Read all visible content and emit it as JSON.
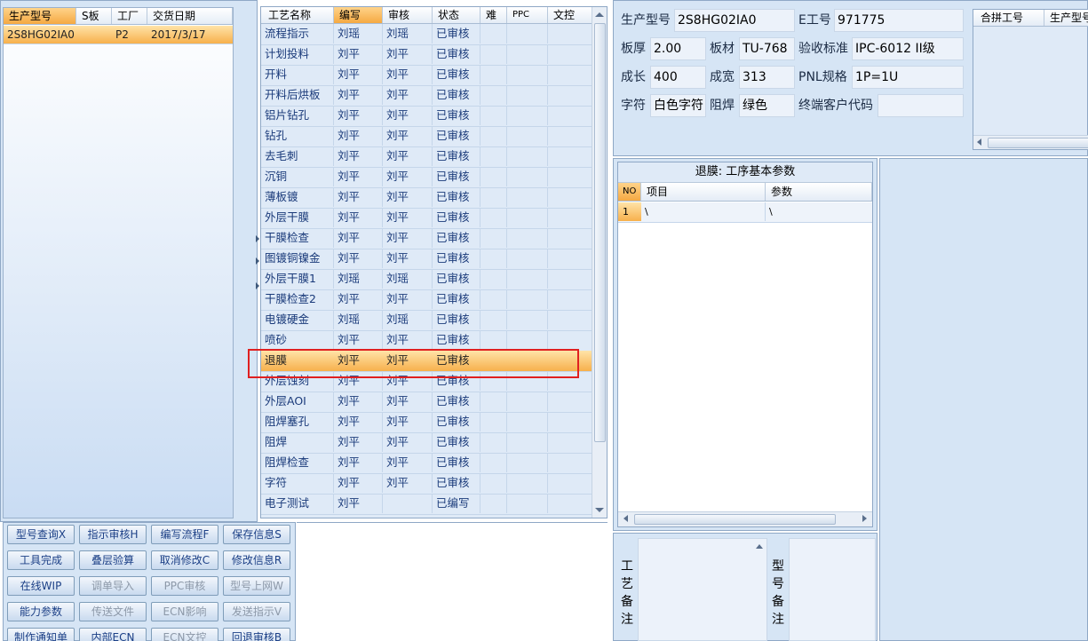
{
  "model_list": {
    "columns": [
      "生产型号",
      "S板",
      "工厂",
      "交货日期"
    ],
    "rows": [
      {
        "model": "2S8HG02IA0",
        "s_board": "",
        "factory": "P2",
        "delivery_date": "2017/3/17"
      }
    ]
  },
  "process_list": {
    "columns": [
      "工艺名称",
      "编写",
      "审核",
      "状态",
      "难",
      "PPC",
      "文控"
    ],
    "rows": [
      {
        "name": "流程指示",
        "writer": "刘瑶",
        "reviewer": "刘瑶",
        "status": "已审核"
      },
      {
        "name": "计划投料",
        "writer": "刘平",
        "reviewer": "刘平",
        "status": "已审核"
      },
      {
        "name": "开料",
        "writer": "刘平",
        "reviewer": "刘平",
        "status": "已审核"
      },
      {
        "name": "开料后烘板",
        "writer": "刘平",
        "reviewer": "刘平",
        "status": "已审核"
      },
      {
        "name": "铝片钻孔",
        "writer": "刘平",
        "reviewer": "刘平",
        "status": "已审核"
      },
      {
        "name": "钻孔",
        "writer": "刘平",
        "reviewer": "刘平",
        "status": "已审核"
      },
      {
        "name": "去毛刺",
        "writer": "刘平",
        "reviewer": "刘平",
        "status": "已审核"
      },
      {
        "name": "沉铜",
        "writer": "刘平",
        "reviewer": "刘平",
        "status": "已审核"
      },
      {
        "name": "薄板镀",
        "writer": "刘平",
        "reviewer": "刘平",
        "status": "已审核"
      },
      {
        "name": "外层干膜",
        "writer": "刘平",
        "reviewer": "刘平",
        "status": "已审核"
      },
      {
        "name": "干膜检查",
        "writer": "刘平",
        "reviewer": "刘平",
        "status": "已审核"
      },
      {
        "name": "图镀铜镍金",
        "writer": "刘平",
        "reviewer": "刘平",
        "status": "已审核"
      },
      {
        "name": "外层干膜1",
        "writer": "刘瑶",
        "reviewer": "刘瑶",
        "status": "已审核"
      },
      {
        "name": "干膜检查2",
        "writer": "刘平",
        "reviewer": "刘平",
        "status": "已审核"
      },
      {
        "name": "电镀硬金",
        "writer": "刘瑶",
        "reviewer": "刘瑶",
        "status": "已审核"
      },
      {
        "name": "喷砂",
        "writer": "刘平",
        "reviewer": "刘平",
        "status": "已审核"
      },
      {
        "name": "退膜",
        "writer": "刘平",
        "reviewer": "刘平",
        "status": "已审核"
      },
      {
        "name": "外层蚀刻",
        "writer": "刘平",
        "reviewer": "刘平",
        "status": "已审核"
      },
      {
        "name": "外层AOI",
        "writer": "刘平",
        "reviewer": "刘平",
        "status": "已审核"
      },
      {
        "name": "阻焊塞孔",
        "writer": "刘平",
        "reviewer": "刘平",
        "status": "已审核"
      },
      {
        "name": "阻焊",
        "writer": "刘平",
        "reviewer": "刘平",
        "status": "已审核"
      },
      {
        "name": "阻焊检查",
        "writer": "刘平",
        "reviewer": "刘平",
        "status": "已审核"
      },
      {
        "name": "字符",
        "writer": "刘平",
        "reviewer": "刘平",
        "status": "已审核"
      },
      {
        "name": "电子测试",
        "writer": "刘平",
        "reviewer": "",
        "status": "已编写"
      }
    ],
    "selected_index": 16
  },
  "buttons": [
    {
      "label": "型号查询X",
      "enabled": true
    },
    {
      "label": "指示审核H",
      "enabled": true
    },
    {
      "label": "编写流程F",
      "enabled": true
    },
    {
      "label": "保存信息S",
      "enabled": true
    },
    {
      "label": "工具完成",
      "enabled": true
    },
    {
      "label": "叠层验算",
      "enabled": true
    },
    {
      "label": "取消修改C",
      "enabled": true
    },
    {
      "label": "修改信息R",
      "enabled": true
    },
    {
      "label": "在线WIP",
      "enabled": true
    },
    {
      "label": "调单导入",
      "enabled": false
    },
    {
      "label": "PPC审核",
      "enabled": false
    },
    {
      "label": "型号上网W",
      "enabled": false
    },
    {
      "label": "能力参数",
      "enabled": true
    },
    {
      "label": "传送文件",
      "enabled": false
    },
    {
      "label": "ECN影响",
      "enabled": false
    },
    {
      "label": "发送指示V",
      "enabled": false
    },
    {
      "label": "制作通知单",
      "enabled": true
    },
    {
      "label": "内部ECN",
      "enabled": true
    },
    {
      "label": "ECN文控",
      "enabled": false
    },
    {
      "label": "回退审核B",
      "enabled": true
    }
  ],
  "info": {
    "model_label": "生产型号",
    "model_value": "2S8HG02IA0",
    "e_label": "E工号",
    "e_value": "971775",
    "thickness_label": "板厚",
    "thickness_value": "2.00",
    "material_label": "板材",
    "material_value": "TU-768",
    "standard_label": "验收标准",
    "standard_value": "IPC-6012 II级",
    "length_label": "成长",
    "length_value": "400",
    "width_label": "成宽",
    "width_value": "313",
    "pnl_label": "PNL规格",
    "pnl_value": "1P=1U",
    "char_label": "字符",
    "char_value": "白色字符",
    "mask_label": "阻焊",
    "mask_value": "绿色",
    "customer_label": "终端客户代码",
    "customer_value": ""
  },
  "combine": {
    "columns": [
      "合拼工号",
      "生产型号"
    ]
  },
  "param_panel": {
    "title": "退膜: 工序基本参数",
    "columns": [
      "NO",
      "项目",
      "参数"
    ],
    "rows": [
      {
        "no": "1",
        "item": "\\",
        "param": "\\"
      }
    ]
  },
  "remarks": {
    "process_label": [
      "工",
      "艺",
      "备",
      "注"
    ],
    "model_label": [
      "型",
      "号",
      "备",
      "注"
    ]
  },
  "colors": {
    "selection": "#f7b04c",
    "highlight_box": "#e02020",
    "panel_bg": "#d6e5f5"
  }
}
